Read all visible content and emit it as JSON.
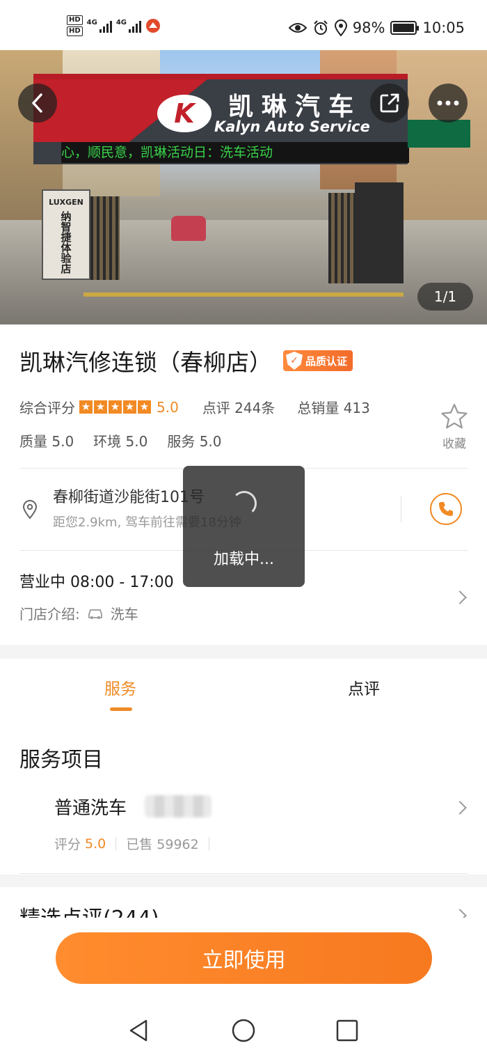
{
  "status_bar": {
    "hd1": "HD",
    "hd2": "HD",
    "sim1_label": "4G",
    "sim2_label": "4G",
    "battery_percent": "98%",
    "battery_level": 0.98,
    "time": "10:05",
    "icons": [
      "eye-icon",
      "alarm-icon",
      "location-icon",
      "battery-icon"
    ]
  },
  "hero": {
    "sign_cn": "凯琳汽车",
    "sign_en": "Kalyn Auto Service",
    "led_text": "心，顺民意，凯琳活动日：洗车活动",
    "post_text": "纳智捷体验店",
    "post_brand": "LUXGEN",
    "pager": "1/1"
  },
  "shop": {
    "name": "凯琳汽修连锁（春柳店）",
    "badge": "品质认证",
    "rating_label": "综合评分",
    "rating_value": "5.0",
    "stars": 5,
    "reviews_text": "点评 244条",
    "sales_text": "总销量 413",
    "quality": "质量 5.0",
    "environment": "环境 5.0",
    "service": "服务 5.0",
    "favorite_label": "收藏",
    "address": "春柳街道沙能街101号",
    "distance": "距您2.9km, 驾车前往需要18分钟",
    "hours": "营业中 08:00 - 17:00",
    "intro_label": "门店介绍:",
    "intro_value": "洗车"
  },
  "tabs": [
    {
      "label": "服务",
      "active": true
    },
    {
      "label": "点评",
      "active": false
    }
  ],
  "services": {
    "title": "服务项目",
    "items": [
      {
        "name": "普通洗车",
        "rating_label": "评分",
        "rating": "5.0",
        "sold": "已售 59962"
      }
    ]
  },
  "reviews": {
    "title": "精选点评(244)"
  },
  "cta": {
    "label": "立即使用"
  },
  "toast": {
    "text": "加载中..."
  },
  "colors": {
    "accent": "#f08a24",
    "toast_bg": "#282828"
  }
}
